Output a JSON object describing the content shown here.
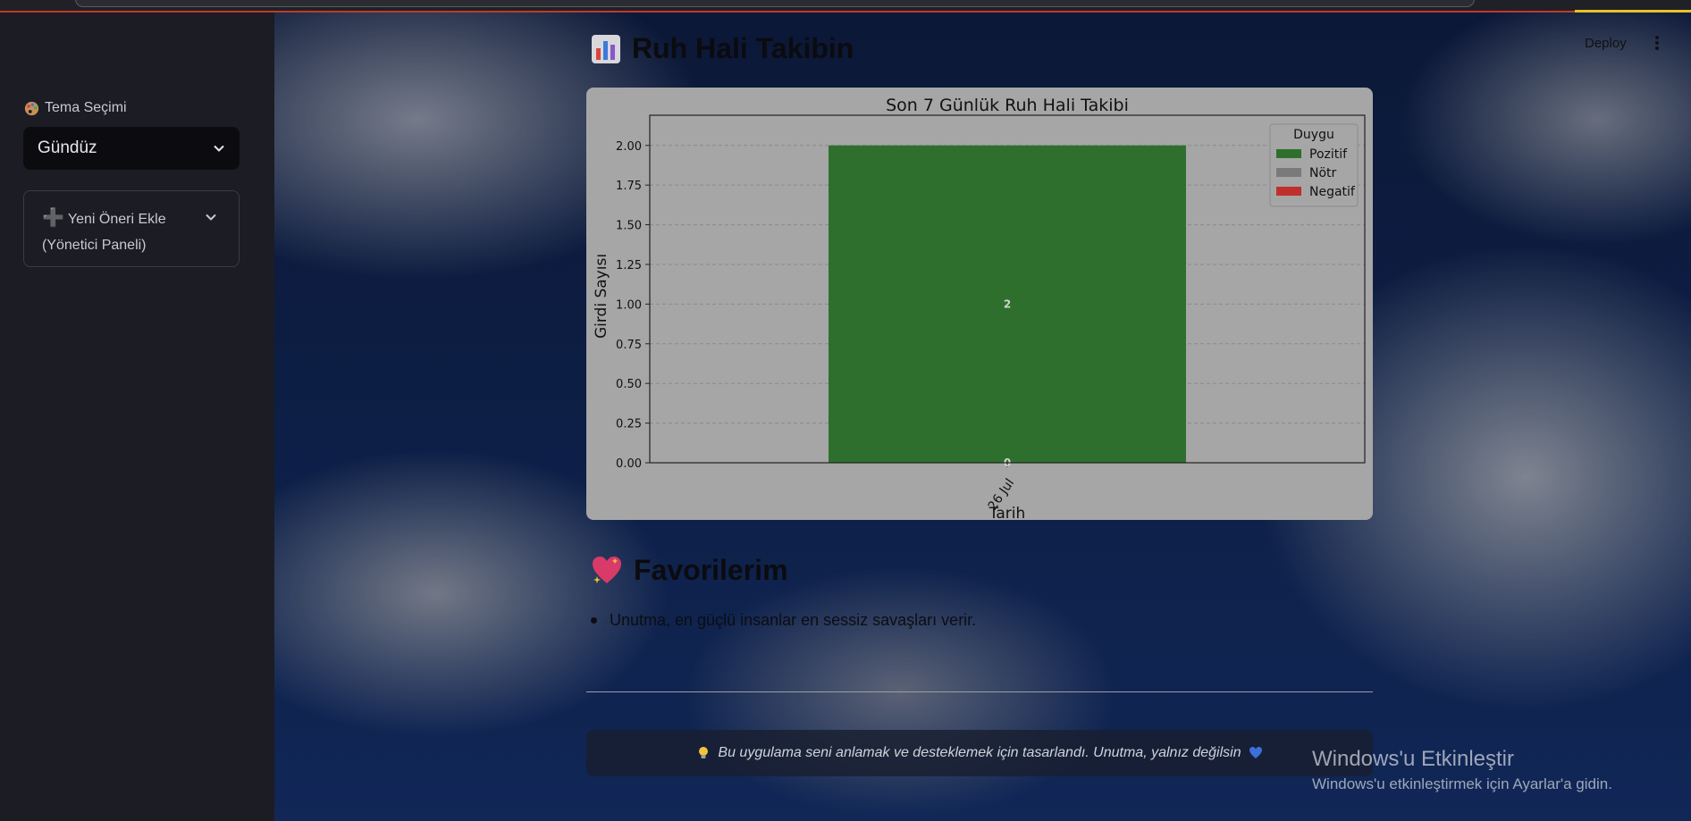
{
  "sidebar": {
    "theme_label": "Tema Seçimi",
    "theme_value": "Gündüz",
    "expander_label": "Yeni Öneri Ekle (Yönetici Paneli)"
  },
  "header": {
    "deploy_label": "Deploy"
  },
  "main": {
    "mood_title": "Ruh Hali Takibin",
    "favorites_title": "Favorilerim",
    "favorites": [
      "Unutma, en güçlü insanlar en sessiz savaşları verir."
    ],
    "footer_text": "Bu uygulama seni anlamak ve desteklemek için tasarlandı. Unutma, yalnız değilsin"
  },
  "watermark": {
    "title": "Windows'u Etkinleştir",
    "subtitle": "Windows'u etkinleştirmek için Ayarlar'a gidin."
  },
  "chart_data": {
    "type": "bar",
    "stacked": true,
    "title": "Son 7 Günlük Ruh Hali Takibi",
    "xlabel": "Tarih",
    "ylabel": "Girdi Sayısı",
    "categories": [
      "26 Jul"
    ],
    "series": [
      {
        "name": "Pozitif",
        "values": [
          2
        ],
        "color": "#2e6f2e"
      },
      {
        "name": "Nötr",
        "values": [
          0
        ],
        "color": "#7a7a7a"
      },
      {
        "name": "Negatif",
        "values": [
          0
        ],
        "color": "#c0302a"
      }
    ],
    "legend_title": "Duygu",
    "legend_position": "top-right",
    "ylim": [
      0,
      2.1
    ],
    "yticks": [
      "0.00",
      "0.25",
      "0.50",
      "0.75",
      "1.00",
      "1.25",
      "1.50",
      "1.75",
      "2.00"
    ],
    "data_labels": [
      "2",
      "0"
    ],
    "grid": true
  }
}
